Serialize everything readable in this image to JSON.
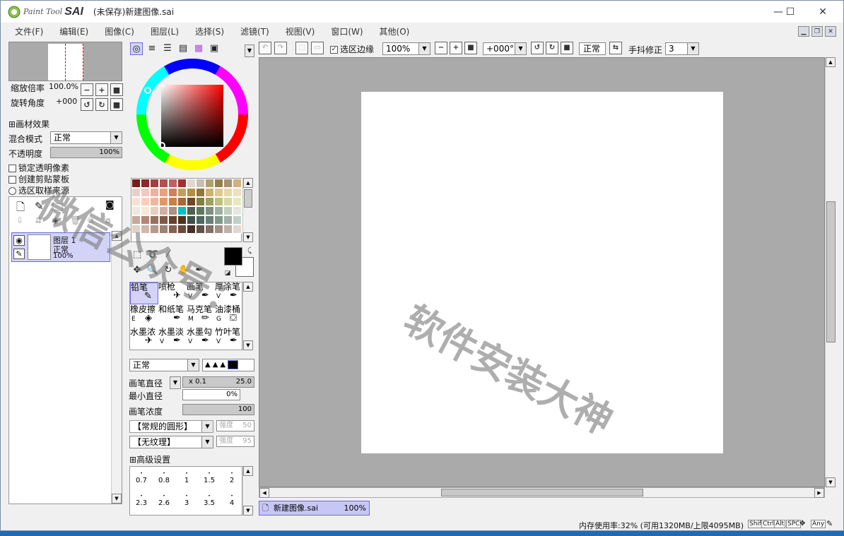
{
  "app": {
    "logo_small": "Paint Tool",
    "logo_big": "SAI",
    "title": "(未保存)新建图像.sai"
  },
  "window_controls": {
    "minimize": "—",
    "maximize": "☐",
    "close": "✕"
  },
  "menu": [
    "文件(F)",
    "编辑(E)",
    "图像(C)",
    "图层(L)",
    "选择(S)",
    "滤镜(T)",
    "视图(V)",
    "窗口(W)",
    "其他(O)"
  ],
  "navigator": {
    "zoom_label": "缩放倍率",
    "zoom_value": "100.0%",
    "rotate_label": "旋转角度",
    "rotate_value": "+000"
  },
  "layer_props": {
    "effects_label": "画材效果",
    "blend_label": "混合模式",
    "blend_value": "正常",
    "opacity_label": "不透明度",
    "opacity_value": "100%",
    "lock_label": "锁定透明像素",
    "clip_label": "创建剪贴蒙板",
    "sample_label": "选区取样来源"
  },
  "layer": {
    "name": "图层 1",
    "mode": "正常",
    "opacity": "100%"
  },
  "brushes": [
    {
      "name": "铅笔",
      "key": ""
    },
    {
      "name": "喷枪",
      "key": ""
    },
    {
      "name": "画笔",
      "key": "V"
    },
    {
      "name": "厚涂笔",
      "key": "V"
    },
    {
      "name": "橡皮擦",
      "key": "E"
    },
    {
      "name": "和纸笔",
      "key": ""
    },
    {
      "name": "马克笔",
      "key": "M"
    },
    {
      "name": "油漆桶",
      "key": "G"
    },
    {
      "name": "水墨浓",
      "key": ""
    },
    {
      "name": "水墨淡",
      "key": "V"
    },
    {
      "name": "水墨勾",
      "key": "V"
    },
    {
      "name": "竹叶笔",
      "key": "V"
    }
  ],
  "brush_settings": {
    "mode": "正常",
    "size_label": "画笔直径",
    "size_mult": "x 0.1",
    "size_value": "25.0",
    "min_label": "最小直径",
    "min_value": "0%",
    "density_label": "画笔浓度",
    "density_value": "100",
    "shape": "【常规的圆形】",
    "shape_strength_label": "强度",
    "shape_strength": "50",
    "texture": "【无纹理】",
    "texture_strength_label": "强度",
    "texture_strength": "95",
    "advanced_label": "高级设置"
  },
  "sizes": [
    "0.7",
    "0.8",
    "1",
    "1.5",
    "2",
    "2.3",
    "2.6",
    "3",
    "3.5",
    "4"
  ],
  "canvas_toolbar": {
    "selection_edge": "选区边缘",
    "zoom": "100%",
    "angle": "+000°",
    "mode": "正常",
    "stabilizer_label": "手抖修正",
    "stabilizer_value": "3"
  },
  "doc_tab": {
    "name": "新建图像.sai",
    "zoom": "100%"
  },
  "status": {
    "memory": "内存使用率:32% (可用1320MB/上限4095MB)",
    "keys": [
      "Shift",
      "Ctrl",
      "Alt",
      "SPC",
      "Any"
    ]
  },
  "watermark": {
    "line1": "微信公众号：",
    "line2": "软件安装大神"
  },
  "palette_colors": [
    "#7b1a1a",
    "#8b2a2a",
    "#a04040",
    "#b05050",
    "#c06060",
    "#a03030",
    "#e0d8d0",
    "#c8c0b0",
    "#b0a070",
    "#908050",
    "#a89070",
    "#d0b080",
    "#e8d0c8",
    "#f0c8c0",
    "#f0b0a0",
    "#e8a080",
    "#d08060",
    "#c0a060",
    "#b09048",
    "#907838",
    "#d0b070",
    "#e0c890",
    "#e8d8a8",
    "#f0e0c0",
    "#f8e0d0",
    "#f8d0b8",
    "#f0b898",
    "#e09868",
    "#c88048",
    "#a86838",
    "#704828",
    "#808040",
    "#a0a060",
    "#c0c080",
    "#d8d8a0",
    "#e8e8c0",
    "#f0e8e0",
    "#f8e8d8",
    "#e8d0c0",
    "#d0b0a0",
    "#b09080",
    "#08c0c0",
    "#506050",
    "#607860",
    "#809080",
    "#a0b0a0",
    "#c0d0c0",
    "#e0e8e0",
    "#c8a898",
    "#b08878",
    "#987060",
    "#805848",
    "#684030",
    "#503020",
    "#405048",
    "#506860",
    "#688078",
    "#80988c",
    "#a0b0a8",
    "#c0d0c8",
    "#e0d0c8",
    "#d0b8a8",
    "#b89888",
    "#a08070",
    "#886050",
    "#704838",
    "#483028",
    "#605048",
    "#807068",
    "#a09088",
    "#c0b0a8",
    "#e0d8d0"
  ]
}
